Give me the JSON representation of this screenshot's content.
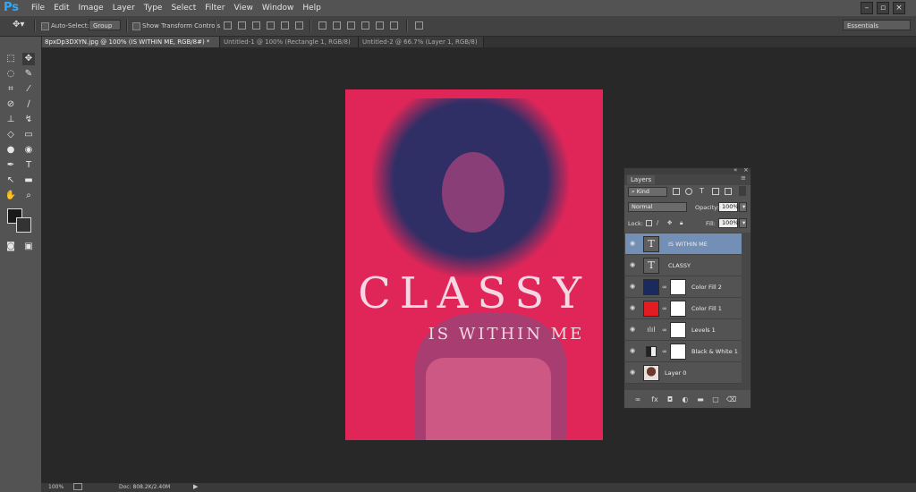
{
  "app": {
    "logo": "Ps"
  },
  "menu": [
    "File",
    "Edit",
    "Image",
    "Layer",
    "Type",
    "Select",
    "Filter",
    "View",
    "Window",
    "Help"
  ],
  "window_controls": [
    "minimize-icon",
    "restore-icon",
    "close-icon"
  ],
  "options_bar": {
    "auto_select_label": "Auto-Select:",
    "auto_select_value": "Group",
    "show_transform_label": "Show Transform Controls",
    "workspace": "Essentials"
  },
  "tabs": [
    {
      "label": "8pxDp3DXYN.jpg @ 100% (IS WITHIN ME, RGB/8#) *",
      "active": true
    },
    {
      "label": "Untitled-1 @ 100% (Rectangle 1, RGB/8) *",
      "active": false
    },
    {
      "label": "Untitled-2 @ 66.7% (Layer 1, RGB/8) *",
      "active": false
    }
  ],
  "artwork": {
    "title": "CLASSY",
    "subtitle": "IS WITHIN ME",
    "background_color": "#e02658"
  },
  "layers_panel": {
    "title": "Layers",
    "filter_kind": "Kind",
    "blend_mode": "Normal",
    "opacity_label": "Opacity:",
    "opacity_value": "100%",
    "lock_label": "Lock:",
    "fill_label": "Fill:",
    "fill_value": "100%",
    "layers": [
      {
        "name": "IS WITHIN ME",
        "type": "text",
        "active": true
      },
      {
        "name": "CLASSY",
        "type": "text",
        "active": false
      },
      {
        "name": "Color Fill 2",
        "type": "fill",
        "color": "#1b2a5e",
        "active": false
      },
      {
        "name": "Color Fill 1",
        "type": "fill",
        "color": "#e21c22",
        "active": false
      },
      {
        "name": "Levels 1",
        "type": "levels",
        "active": false
      },
      {
        "name": "Black & White 1",
        "type": "bw",
        "active": false
      },
      {
        "name": "Layer 0",
        "type": "image",
        "active": false
      }
    ]
  },
  "status": {
    "zoom": "100%",
    "doc": "Doc: 808.2K/2.40M"
  }
}
